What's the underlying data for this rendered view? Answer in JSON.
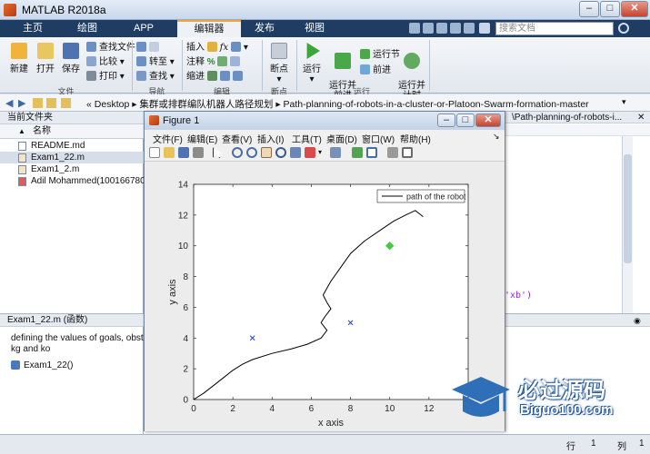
{
  "window": {
    "title": "MATLAB R2018a",
    "controls": {
      "minimize": "–",
      "maximize": "□",
      "close": "✕"
    }
  },
  "tabs": [
    {
      "label": "主页",
      "active": false
    },
    {
      "label": "绘图",
      "active": false
    },
    {
      "label": "APP",
      "active": false
    },
    {
      "label": "编辑器",
      "active": true
    },
    {
      "label": "发布",
      "active": false
    },
    {
      "label": "视图",
      "active": false
    }
  ],
  "search": {
    "placeholder": "搜索文档"
  },
  "ribbon": {
    "file": {
      "new": "新建",
      "open": "打开",
      "save": "保存",
      "find_files": "查找文件",
      "compare": "比较",
      "print": "打印",
      "group": "文件"
    },
    "navigate": {
      "goto": "转至",
      "find": "查找",
      "group": "导航"
    },
    "edit": {
      "insert": "插入",
      "fx": "fx",
      "comment": "注释",
      "comment_pct": "%",
      "indent": "缩进",
      "group": "编辑"
    },
    "breakpoints": {
      "label": "断点",
      "group": "断点"
    },
    "run": {
      "run": "运行",
      "run_advance": "运行并\n前进",
      "run_section": "运行节",
      "advance": "前进",
      "run_time": "运行并\n计时",
      "group": "运行"
    }
  },
  "address": {
    "prefix": "«",
    "path": [
      "Desktop",
      "集群或排群编队机器人路径规划",
      "Path-planning-of-robots-in-a-cluster-or-Platoon-Swarm-formation-master"
    ],
    "sep": "▸"
  },
  "folder_panel": {
    "header": "当前文件夹",
    "column": "名称",
    "sort": "▲",
    "files": [
      {
        "name": "README.md",
        "selected": false
      },
      {
        "name": "Exam1_22.m",
        "selected": true
      },
      {
        "name": "Exam1_2.m",
        "selected": false
      },
      {
        "name": "Adil Mohammed(1001667808)",
        "selected": false
      }
    ]
  },
  "details_panel": {
    "header": "Exam1_22.m  (函数)",
    "description": [
      "defining the values of goals, obstac",
      "kg and ko"
    ],
    "function_item": "Exam1_22()"
  },
  "editor": {
    "tab_path": "\\Path-planning-of-robots-i...",
    "code_fragment": "'xb')"
  },
  "status": {
    "row_label": "行",
    "row": "1",
    "col_label": "列",
    "col": "1"
  },
  "figure": {
    "title": "Figure 1",
    "menu": [
      "文件(F)",
      "编辑(E)",
      "查看(V)",
      "插入(I)",
      "工具(T)",
      "桌面(D)",
      "窗口(W)",
      "帮助(H)"
    ]
  },
  "watermark": {
    "title": "必过源码",
    "url": "Biguo100.com"
  },
  "chart_data": {
    "type": "line",
    "title": "",
    "xlabel": "x axis",
    "ylabel": "y axis",
    "xlim": [
      0,
      14
    ],
    "ylim": [
      0,
      14
    ],
    "xticks": [
      0,
      2,
      4,
      6,
      8,
      10,
      12,
      14
    ],
    "yticks": [
      0,
      2,
      4,
      6,
      8,
      10,
      12,
      14
    ],
    "grid": false,
    "legend_position": "top-right",
    "series": [
      {
        "name": "path of the robot",
        "color": "#000000",
        "x": [
          0,
          0.5,
          1.0,
          1.5,
          2.0,
          2.5,
          3.0,
          4.0,
          5.0,
          5.8,
          6.5,
          6.8,
          6.5,
          6.7,
          7.0,
          6.8,
          6.6,
          7.0,
          7.5,
          8.0,
          8.7,
          9.5,
          10.2,
          10.8,
          11.3,
          11.7
        ],
        "y": [
          0,
          0.4,
          0.9,
          1.4,
          1.9,
          2.3,
          2.6,
          3.0,
          3.3,
          3.6,
          4.0,
          4.5,
          5.0,
          5.4,
          5.9,
          6.3,
          6.8,
          7.7,
          8.6,
          9.5,
          10.3,
          11.0,
          11.6,
          12.0,
          12.3,
          11.9
        ]
      }
    ],
    "markers": [
      {
        "x": 3,
        "y": 4,
        "symbol": "x",
        "color": "#2a3fcf"
      },
      {
        "x": 8,
        "y": 5,
        "symbol": "x",
        "color": "#2a3fcf"
      },
      {
        "x": 10,
        "y": 10,
        "symbol": "diamond",
        "color": "#44cc44"
      }
    ]
  }
}
